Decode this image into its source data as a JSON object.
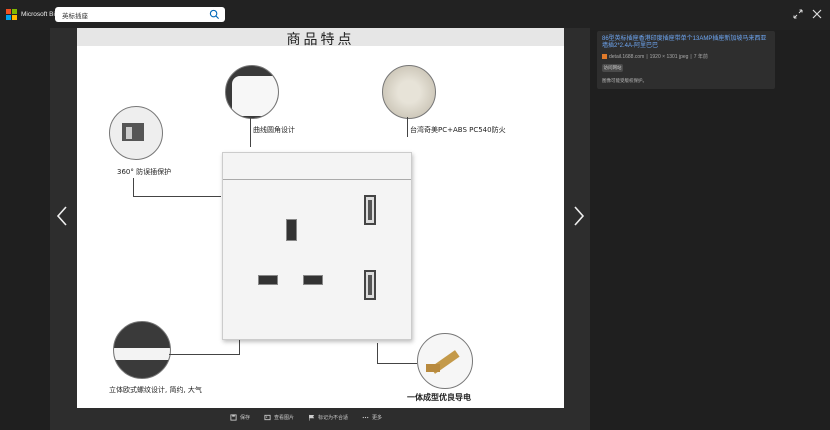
{
  "brand": {
    "name": "Microsoft Bing",
    "colors": [
      "#f25022",
      "#7fba00",
      "#00a4ef",
      "#ffb900"
    ]
  },
  "search": {
    "query": "英标插座"
  },
  "image": {
    "title": "商品特点",
    "labels": {
      "rounded": "曲线圆角设计",
      "material": "台湾奇美PC+ABS PC540防火",
      "anti_misplug": "360° 防误插保护",
      "texture": "立体欧式螺纹设计, 简约, 大气",
      "conductor": "一体成型优良导电"
    }
  },
  "panel": {
    "title": "86型英标插座香港印度插座带单个13AMP插座新加坡马来西亚墙插2*2.4A-阿里巴巴",
    "source": "detail.1688.com",
    "dimensions": "1920 × 1301 jpeg",
    "age": "7 年前",
    "visit_label": "访问网站",
    "note": "图像可能受版权保护。"
  },
  "bottom": {
    "save": "保存",
    "search_image": "查看图片",
    "flag": "标记为不合适",
    "more": "更多"
  }
}
